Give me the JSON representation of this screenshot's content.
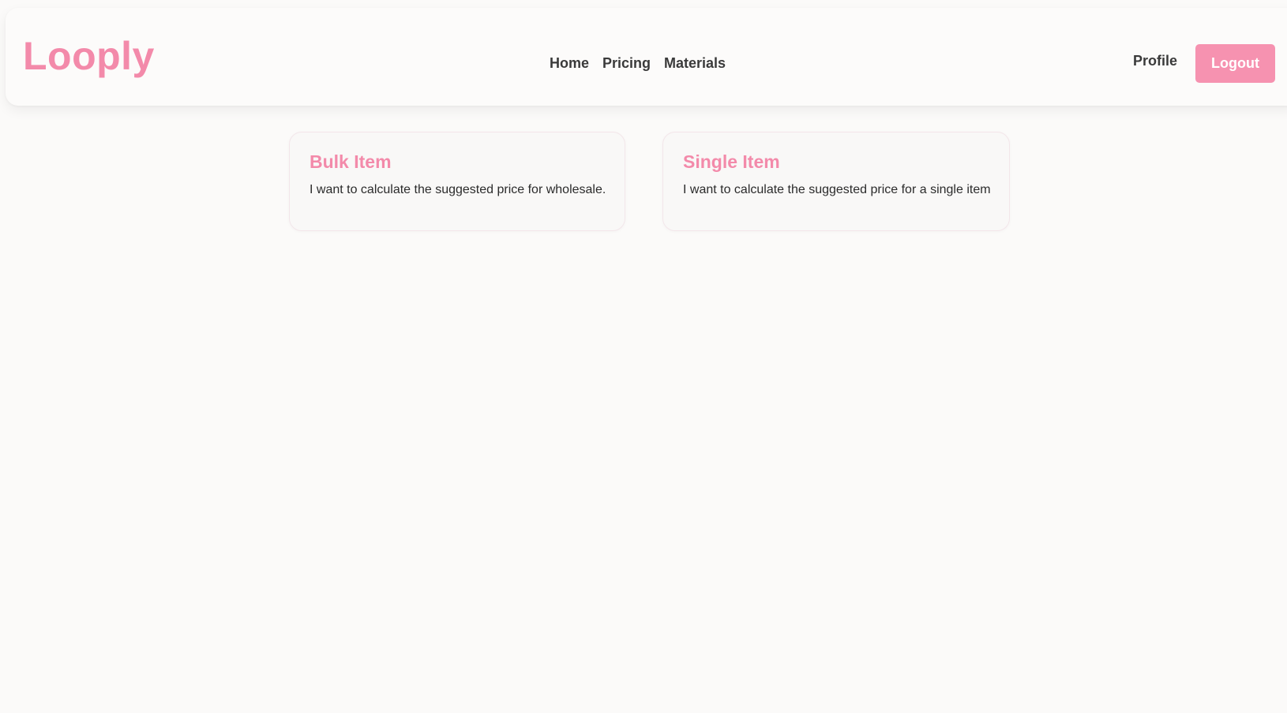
{
  "brand": {
    "name": "Looply",
    "accent_color": "#f38aaa"
  },
  "nav": {
    "links": [
      {
        "label": "Home"
      },
      {
        "label": "Pricing"
      },
      {
        "label": "Materials"
      }
    ],
    "profile_label": "Profile",
    "logout_label": "Logout"
  },
  "cards": [
    {
      "title": "Bulk Item",
      "description": "I want to calculate the suggested price for wholesale."
    },
    {
      "title": "Single Item",
      "description": "I want to calculate the suggested price for a single item"
    }
  ]
}
